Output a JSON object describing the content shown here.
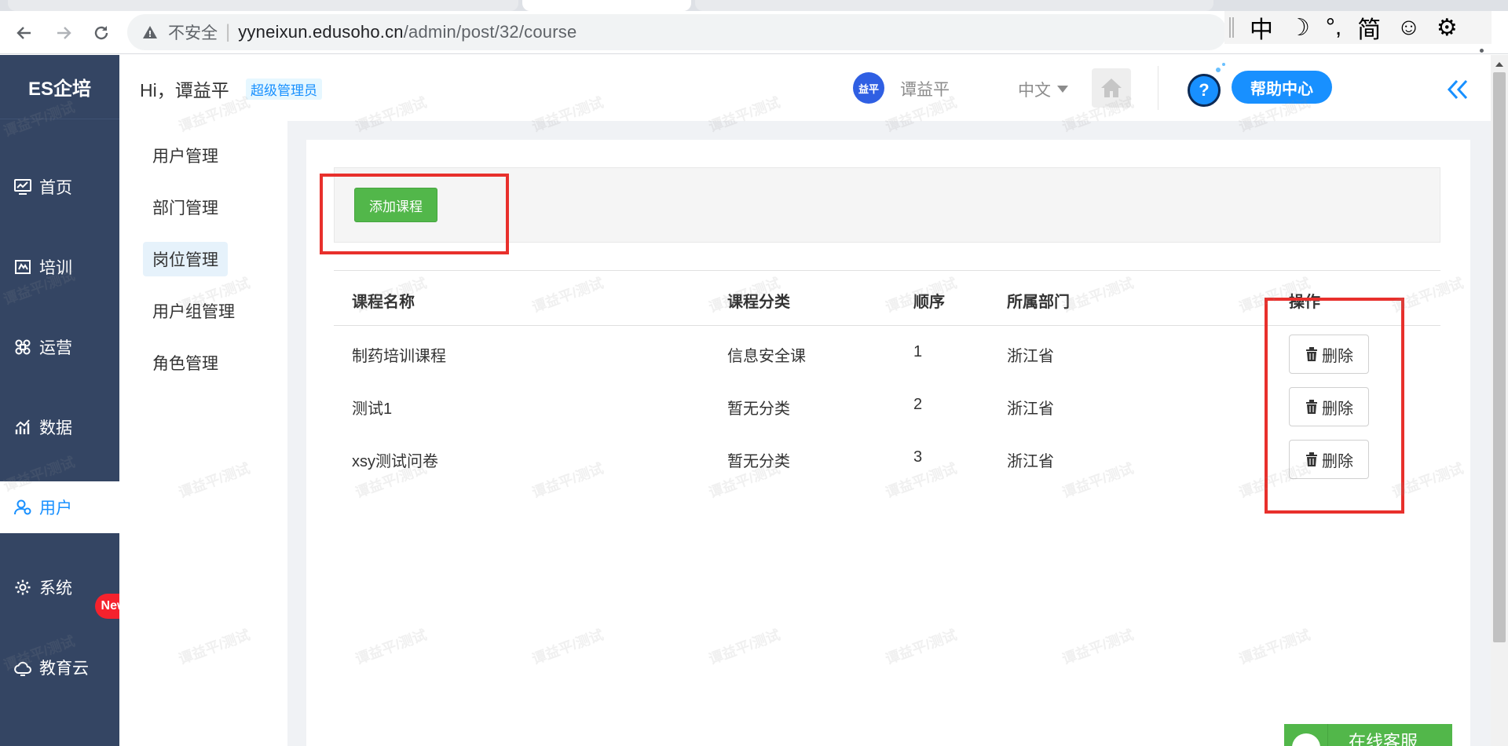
{
  "browser": {
    "insecure_label": "不安全",
    "url_host": "yyneixun.edusoho.cn",
    "url_path": "/admin/post/32/course",
    "ime": [
      "中",
      "☽",
      "°,",
      "简",
      "☺",
      "⚙"
    ]
  },
  "sidebar": {
    "brand": "ES企培",
    "items": [
      {
        "label": "首页",
        "icon": "dashboard-icon"
      },
      {
        "label": "培训",
        "icon": "training-icon"
      },
      {
        "label": "运营",
        "icon": "operations-icon"
      },
      {
        "label": "数据",
        "icon": "data-chart-icon"
      },
      {
        "label": "用户",
        "icon": "user-icon"
      },
      {
        "label": "系统",
        "icon": "gear-icon"
      },
      {
        "label": "教育云",
        "icon": "cloud-icon"
      }
    ],
    "active_item": "用户",
    "new_badge": "New"
  },
  "header": {
    "greeting": "Hi，谭益平",
    "role_badge": "超级管理员",
    "avatar_text": "益平",
    "user_name": "谭益平",
    "language": "中文",
    "help_icon_glyph": "?",
    "help_center": "帮助中心",
    "collapse_glyph": "«"
  },
  "subnav": {
    "items": [
      "用户管理",
      "部门管理",
      "岗位管理",
      "用户组管理",
      "角色管理"
    ],
    "active_item": "岗位管理"
  },
  "main": {
    "add_course_button": "添加课程",
    "table": {
      "headers": [
        "课程名称",
        "课程分类",
        "顺序",
        "所属部门",
        "操作"
      ],
      "rows": [
        {
          "name": "制药培训课程",
          "category": "信息安全课",
          "order": "1",
          "dept": "浙江省",
          "action": "删除"
        },
        {
          "name": "测试1",
          "category": "暂无分类",
          "order": "2",
          "dept": "浙江省",
          "action": "删除"
        },
        {
          "name": "xsy测试问卷",
          "category": "暂无分类",
          "order": "3",
          "dept": "浙江省",
          "action": "删除"
        }
      ]
    }
  },
  "online_service": {
    "label": "在线客服"
  },
  "watermark": "谭益平/测试",
  "colors": {
    "sidebar_bg": "#344563",
    "accent_blue": "#1890ff",
    "add_button_green": "#52b74a",
    "highlight_red": "#e8302c",
    "content_bg": "#f0f2f5"
  }
}
